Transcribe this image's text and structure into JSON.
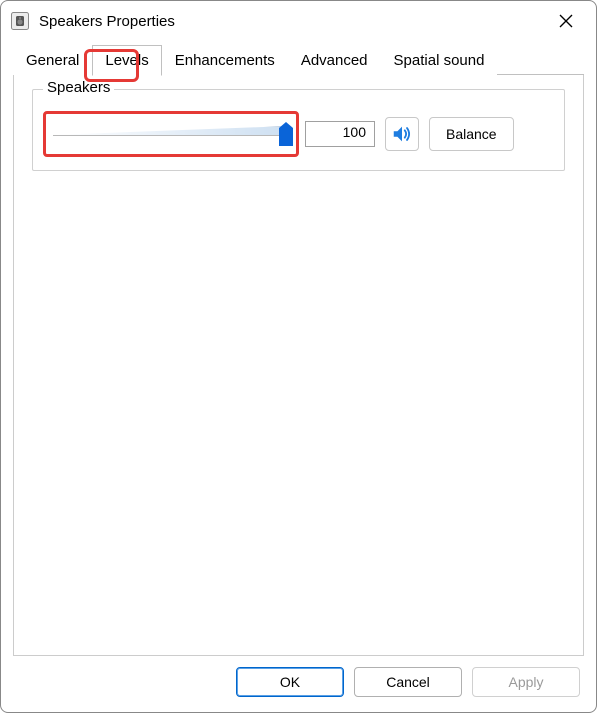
{
  "window": {
    "title": "Speakers Properties"
  },
  "tabs": {
    "general": "General",
    "levels": "Levels",
    "enhancements": "Enhancements",
    "advanced": "Advanced",
    "spatial_sound": "Spatial sound",
    "selected": "Levels"
  },
  "group": {
    "legend": "Speakers",
    "volume_value": "100",
    "balance_label": "Balance"
  },
  "buttons": {
    "ok": "OK",
    "cancel": "Cancel",
    "apply": "Apply"
  },
  "colors": {
    "highlight": "#e53935",
    "accent": "#0066cc",
    "thumb": "#0a64d8"
  },
  "highlights": {
    "levels_tab": true,
    "slider": true
  }
}
